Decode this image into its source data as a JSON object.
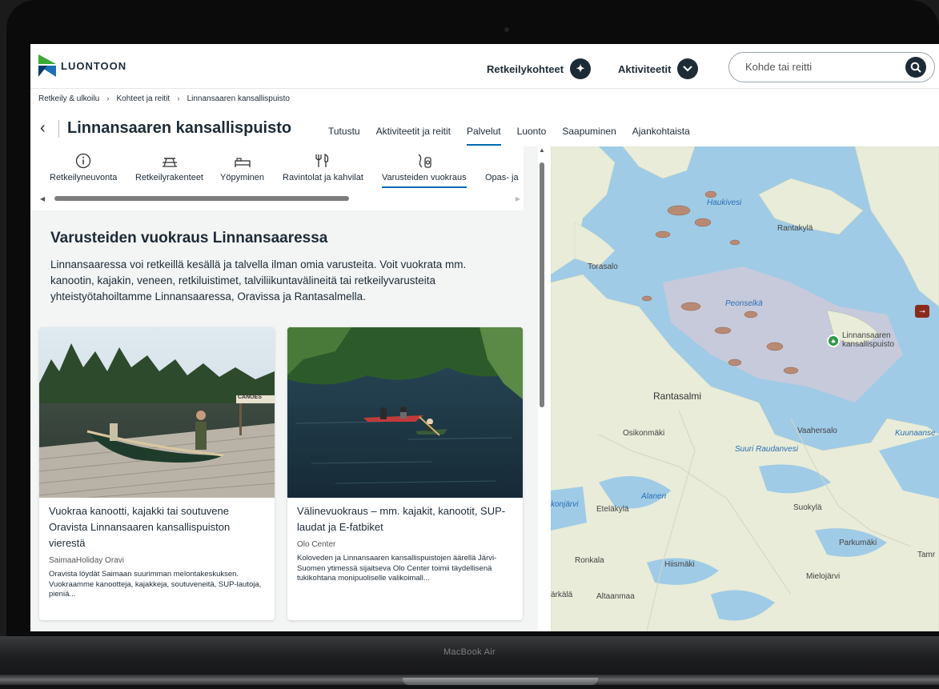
{
  "device": {
    "brand_label": "MacBook Air"
  },
  "header": {
    "logo_text": "LUONTOON",
    "nav": [
      {
        "label": "Retkeilykohteet",
        "icon": "hiker-icon"
      },
      {
        "label": "Aktiviteetit",
        "icon": "chevron-down-icon"
      }
    ],
    "search": {
      "placeholder": "Kohde tai reitti",
      "value": ""
    }
  },
  "breadcrumb": [
    "Retkeily & ulkoilu",
    "Kohteet ja reitit",
    "Linnansaaren kansallispuisto"
  ],
  "page": {
    "title": "Linnansaaren kansallispuisto",
    "tabs": [
      {
        "label": "Tutustu",
        "active": false
      },
      {
        "label": "Aktiviteetit ja reitit",
        "active": false
      },
      {
        "label": "Palvelut",
        "active": true
      },
      {
        "label": "Luonto",
        "active": false
      },
      {
        "label": "Saapuminen",
        "active": false
      },
      {
        "label": "Ajankohtaista",
        "active": false
      }
    ]
  },
  "services": [
    {
      "label": "Retkeilyneuvonta",
      "icon": "info-icon",
      "glyph": "ⓘ"
    },
    {
      "label": "Retkeilyrakenteet",
      "icon": "picnic-table-icon",
      "glyph": "⊼"
    },
    {
      "label": "Yöpyminen",
      "icon": "bed-icon",
      "glyph": "⊶"
    },
    {
      "label": "Ravintolat ja kahvilat",
      "icon": "fork-knife-icon",
      "glyph": "Ψ"
    },
    {
      "label": "Varusteiden vuokraus",
      "icon": "equipment-icon",
      "glyph": "⚲",
      "active": true
    },
    {
      "label": "Opas- ja",
      "icon": "",
      "glyph": ""
    }
  ],
  "content": {
    "heading": "Varusteiden vuokraus Linnansaaressa",
    "intro": "Linnansaaressa voi retkeillä kesällä ja talvella ilman omia varusteita. Voit vuokrata mm. kanootin, kajakin, veneen, retkiluistimet, talviliikuntavälineitä tai retkeilyvarusteita yhteistyötahoiltamme Linnansaaressa, Oravissa ja Rantasalmella.",
    "cards": [
      {
        "title": "Vuokraa kanootti, kajakki tai soutuvene Oravista Linnansaaren kansallispuiston vierestä",
        "org": "SaimaaHoliday Oravi",
        "desc": "Oravista löydät Saimaan suurimman melontakeskuksen. Vuokraamme kanootteja, kajakkeja, soutuveneitä, SUP-lautoja, pieniä...",
        "sign": "CANOES"
      },
      {
        "title": "Välinevuokraus – mm. kajakit, kanootit, SUP-laudat ja E-fatbiket",
        "org": "Olo Center",
        "desc": "Koloveden ja Linnansaaren kansallispuistojen äärellä Järvi-Suomen ytimessä sijaitseva Olo Center toimii täydellisenä tukikohtana monipuoliselle valikoimall..."
      }
    ]
  },
  "map": {
    "water_color": "#9fcbe6",
    "land_color": "#e8ecd8",
    "labels": {
      "haukivesi": "Haukivesi",
      "rantakyla": "Rantakylä",
      "torasalo": "Torasalo",
      "peonselka": "Peonselkä",
      "park": "Linnansaaren kansallispuisto",
      "rantasalmi": "Rantasalmi",
      "osikonmaki": "Osikonmäki",
      "vaahersalo": "Vaahersalo",
      "suuri_raudanvesi": "Suuri Raudanvesi",
      "kuunaanse": "Kuunaanse",
      "alanen": "Alanen",
      "konjarvi": "konjärvi",
      "etelakyla": "Eteläkylä",
      "suokyla": "Suokylä",
      "parkumaki": "Parkumäki",
      "tamr": "Tamr",
      "ronkala": "Ronkala",
      "hiismaki": "Hiismäki",
      "mielojarvi": "Mielojärvi",
      "arkala": "ärkälä",
      "altaanmaa": "Altaanmaa"
    }
  }
}
